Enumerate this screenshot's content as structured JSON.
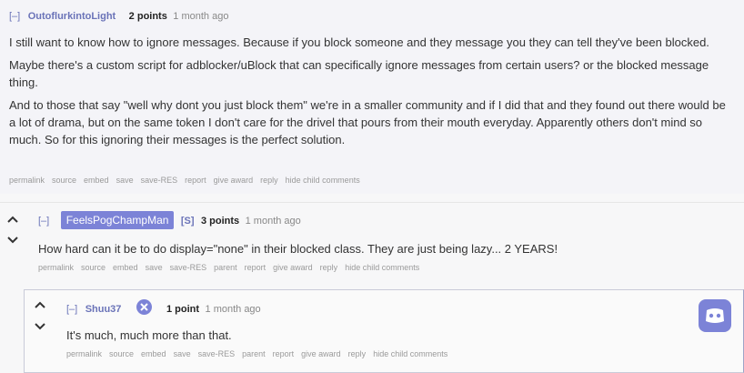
{
  "comment1": {
    "collapse": "[–]",
    "author": "OutoflurkintoLight",
    "points": "2 points",
    "time": "1 month ago",
    "paragraphs": [
      "I still want to know how to ignore messages. Because if you block someone and they message you they can tell they've been blocked.",
      "Maybe there's a custom script for adblocker/uBlock that can specifically ignore messages from certain users? or the blocked message thing.",
      "And to those that say \"well why dont you just block them\" we're in a smaller community and if I did that and they found out there would be a lot of drama, but on the same token I don't care for the drivel that pours from their mouth everyday. Apparently others don't mind so much. So for this ignoring their messages is the perfect solution."
    ],
    "actions": [
      "permalink",
      "source",
      "embed",
      "save",
      "save-RES",
      "report",
      "give award",
      "reply",
      "hide child comments"
    ]
  },
  "comment2": {
    "collapse": "[–]",
    "author": "FeelsPogChampMan",
    "op_tag": "[S]",
    "points": "3 points",
    "time": "1 month ago",
    "text": "How hard can it be to do display=\"none\" in their blocked class. They are just being lazy... 2 YEARS!",
    "actions": [
      "permalink",
      "source",
      "embed",
      "save",
      "save-RES",
      "parent",
      "report",
      "give award",
      "reply",
      "hide child comments"
    ]
  },
  "comment3": {
    "collapse": "[–]",
    "author": "Shuu37",
    "points": "1 point",
    "time": "1 month ago",
    "text": "It's much, much more than that.",
    "actions": [
      "permalink",
      "source",
      "embed",
      "save",
      "save-RES",
      "parent",
      "report",
      "give award",
      "reply",
      "hide child comments"
    ]
  },
  "icons": {
    "upvote": "upvote-arrow",
    "downvote": "downvote-arrow",
    "badge": "tools-badge",
    "discord": "discord-logo"
  }
}
